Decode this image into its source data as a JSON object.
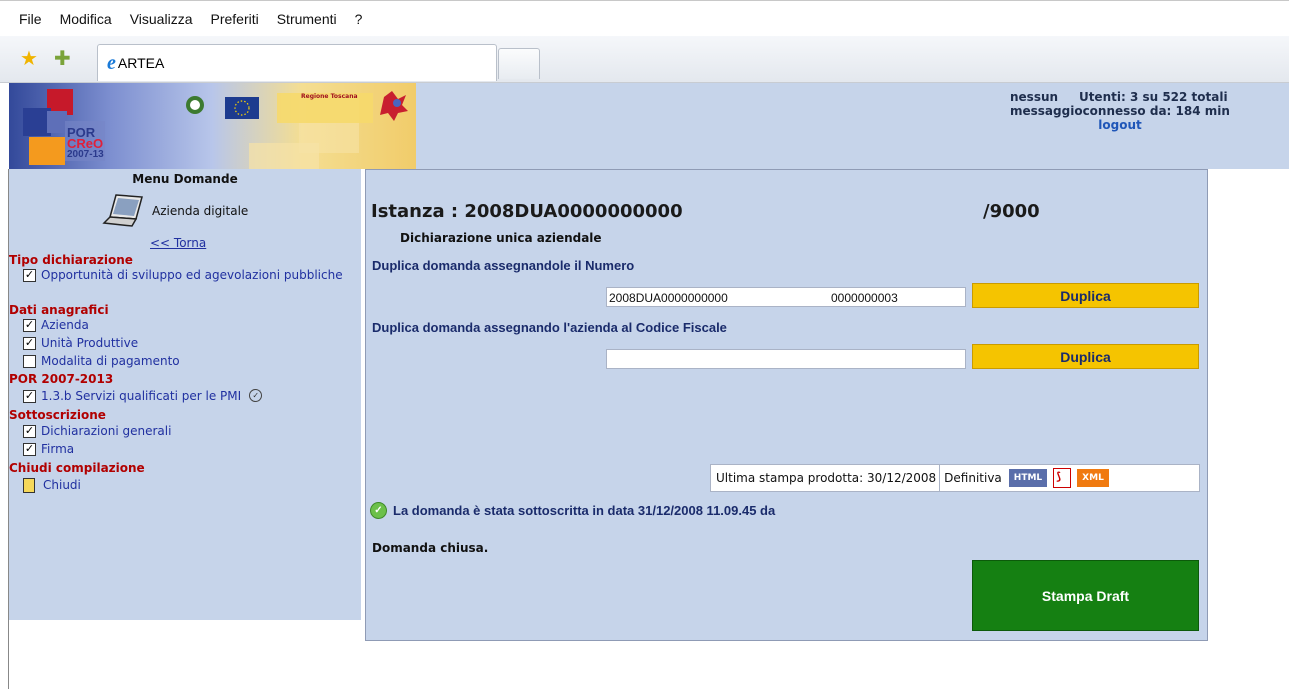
{
  "menubar": [
    "File",
    "Modifica",
    "Visualizza",
    "Preferiti",
    "Strumenti",
    "?"
  ],
  "tab": {
    "title": "ARTEA"
  },
  "banner": {
    "por": "POR",
    "creo": "CReO",
    "years": "2007-13",
    "region": "Regione Toscana"
  },
  "user": {
    "name": "nessun",
    "users": "Utenti: 3 su 522 totali",
    "messages": "messaggioconnesso da: 184 min",
    "logout": "logout"
  },
  "sidebar": {
    "title": "Menu Domande",
    "azienda": "Azienda digitale",
    "back": "<< Torna",
    "sections": [
      {
        "title": "Tipo dichiarazione",
        "items": [
          {
            "label": "Opportunità di sviluppo ed agevolazioni pubbliche",
            "checked": true
          }
        ]
      },
      {
        "title": "Dati anagrafici",
        "items": [
          {
            "label": "Azienda",
            "checked": true
          },
          {
            "label": "Unità Produttive",
            "checked": true
          },
          {
            "label": "Modalita di pagamento",
            "checked": false
          }
        ]
      },
      {
        "title": "POR 2007-2013",
        "items": [
          {
            "label": "1.3.b Servizi qualificati per le PMI",
            "checked": true
          }
        ]
      },
      {
        "title": "Sottoscrizione",
        "items": [
          {
            "label": "Dichiarazioni generali",
            "checked": true
          },
          {
            "label": "Firma",
            "checked": true
          }
        ]
      },
      {
        "title": "Chiudi compilazione",
        "items": [
          {
            "label": "Chiudi"
          }
        ]
      }
    ]
  },
  "main": {
    "istanza": "Istanza : 2008DUA0000000000",
    "istanza_num": "/9000",
    "subtitle": "Dichiarazione unica aziendale",
    "dup_numero_label": "Duplica domanda assegnandole il Numero",
    "dup_numero_prefix": "2008DUA0000000000",
    "dup_numero_value": "0000000003",
    "duplica": "Duplica",
    "dup_cf_label": "Duplica domanda assegnando l'azienda al Codice Fiscale",
    "dup_cf_value": "",
    "stampa_text": "Ultima stampa prodotta: 30/12/2008",
    "stampa_type": "Definitiva",
    "html_badge": "HTML",
    "xml_badge": "XML",
    "sottoscritta": "La domanda è stata sottoscritta in data 31/12/2008 11.09.45 da",
    "chiusa": "Domanda chiusa.",
    "stampa_draft": "Stampa Draft"
  }
}
